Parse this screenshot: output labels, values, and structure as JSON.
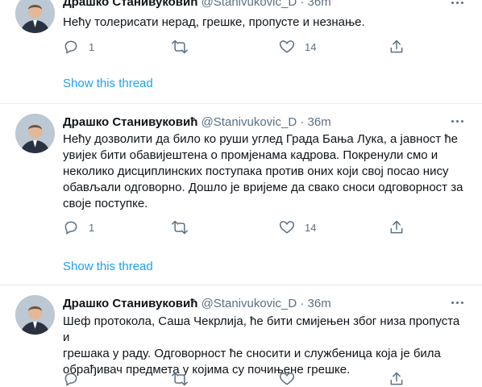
{
  "tweets": [
    {
      "name": "Драшко Станивуковић",
      "handle": "@Stanivukovic_D",
      "dot": "·",
      "time": "36m",
      "text": "Нећу толерисати нерад, грешке, пропусте и незнање.",
      "replies": "1",
      "retweets": "",
      "likes": "14",
      "thread_link": "Show this thread"
    },
    {
      "name": "Драшко Станивуковић",
      "handle": "@Stanivukovic_D",
      "dot": "·",
      "time": "36m",
      "text": "Нећу дозволити да било ко руши углед Града Бања Лука, а јавност ће\nувијек бити обавијештена о промјенама кадрова. Покренули смо и\nнеколико дисциплинских поступака против оних који свој посао нису\nобављали одговорно. Дошло је вријеме да свако сноси одговорност за\nсвоје поступке.",
      "replies": "1",
      "retweets": "",
      "likes": "14",
      "thread_link": "Show this thread"
    },
    {
      "name": "Драшко Станивуковић",
      "handle": "@Stanivukovic_D",
      "dot": "·",
      "time": "36m",
      "text": "Шеф протокола, Саша Чекрлија, ће бити смијењен због низа пропуста и\nгрешака у раду. Одговорност ће сносити и службеница која је била\nобрађивач предмета у којима су почињене грешке.",
      "replies": "",
      "retweets": "",
      "likes": "",
      "thread_link": ""
    }
  ],
  "icons": {
    "reply": "reply-icon",
    "retweet": "retweet-icon",
    "like": "heart-icon",
    "share": "share-icon",
    "more": "more-icon"
  },
  "colors": {
    "link": "#1da1f2",
    "secondary_text": "#5b7083",
    "separator": "#e6ecf0"
  }
}
